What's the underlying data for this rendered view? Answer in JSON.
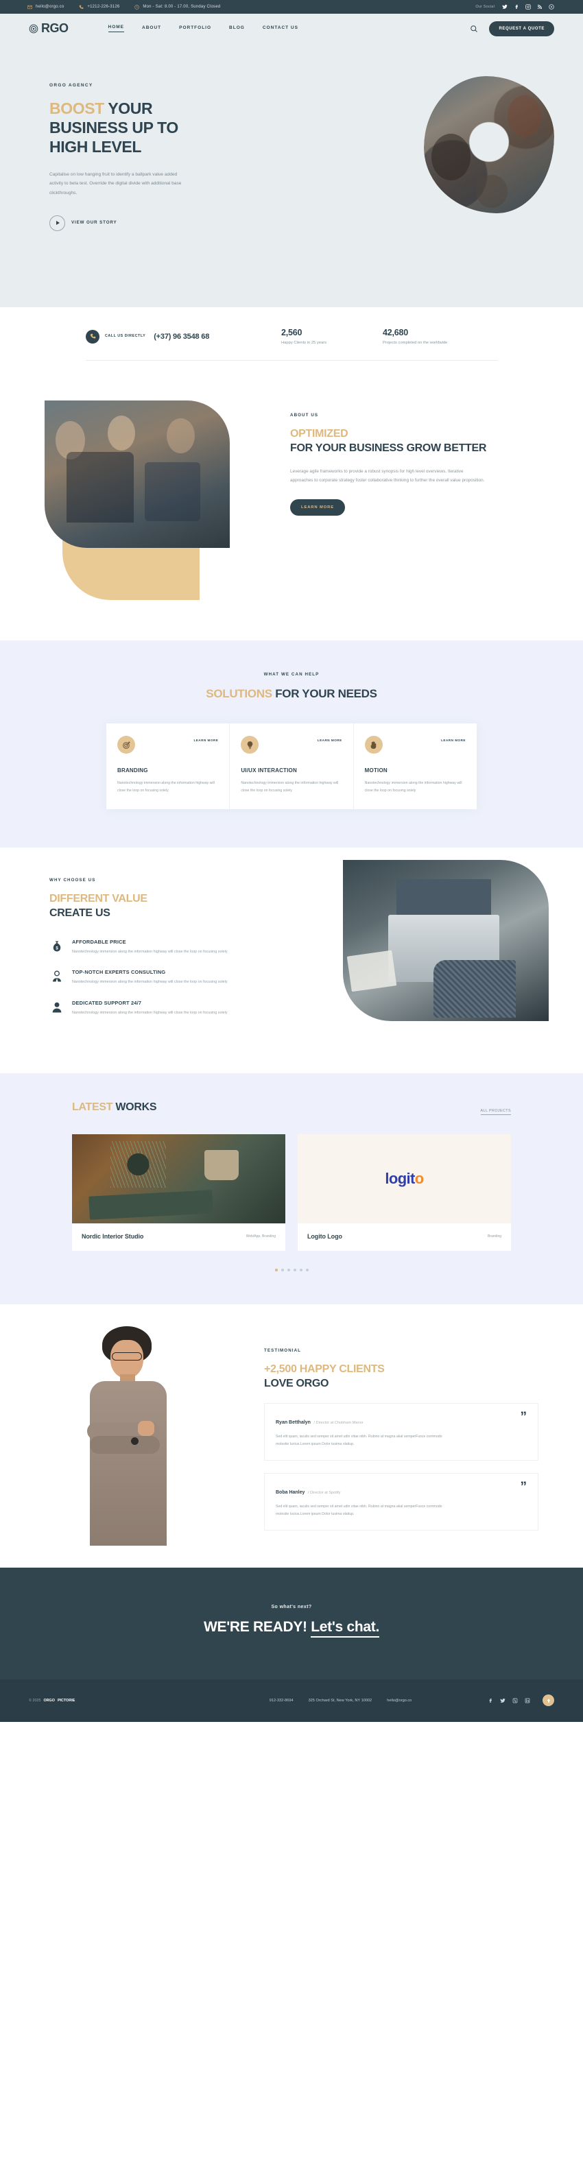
{
  "topbar": {
    "email": "hello@orgo.co",
    "phone": "+1212-226-3126",
    "hours": "Mon - Sat: 8.00 - 17.00, Sunday Closed",
    "social_label": "Our Social",
    "social": [
      "twitter-icon",
      "facebook-icon",
      "instagram-icon",
      "rss-icon",
      "youtube-icon"
    ]
  },
  "nav": {
    "brand": "RGO",
    "items": [
      {
        "label": "HOME",
        "active": true
      },
      {
        "label": "ABOUT",
        "active": false
      },
      {
        "label": "PORTFOLIO",
        "active": false
      },
      {
        "label": "BLOG",
        "active": false
      },
      {
        "label": "CONTACT US",
        "active": false
      }
    ],
    "quote_button": "REQUEST A QUOTE"
  },
  "hero": {
    "eyebrow": "ORGO AGENCY",
    "title_accent": "BOOST",
    "title_rest": " YOUR BUSINESS UP TO HIGH LEVEL",
    "description": "Capitalise on low hanging fruit to identify a ballpark value added activity to beta test. Override the digital divide with additional base clickthroughs.",
    "play_label": "VIEW OUR STORY"
  },
  "stats": {
    "call_label": "CALL US DIRECTLY",
    "call_number": "(+37) 96 3548 68",
    "items": [
      {
        "number": "2,560",
        "label": "Happy Clients in 25 years"
      },
      {
        "number": "42,680",
        "label": "Projects completed on the worldwide"
      }
    ]
  },
  "about": {
    "eyebrow": "ABOUT US",
    "title_accent": "OPTIMIZED",
    "title_rest": "FOR YOUR BUSINESS GROW BETTER",
    "description": "Leverage agile frameworks to provide a robust synopsis for high level overviews. Iterative approaches to corporate strategy foster collaborative thinking to further the overall value proposition.",
    "button": "LEARN MORE"
  },
  "solutions": {
    "eyebrow": "WHAT WE CAN HELP",
    "title_accent": "SOLUTIONS",
    "title_rest": " FOR YOUR NEEDS",
    "learn_more": "LEARN MORE",
    "cards": [
      {
        "icon": "target-icon",
        "title": "BRANDING",
        "text": "Nanotechnology immersion along the information highway will close the loop on focusing solely"
      },
      {
        "icon": "lightbulb-icon",
        "title": "UI/UX INTERACTION",
        "text": "Nanotechnology immersion along the information highway will close the loop on focusing solely"
      },
      {
        "icon": "hand-icon",
        "title": "MOTION",
        "text": "Nanotechnology immersion along the information highway will close the loop on focusing solely"
      }
    ]
  },
  "why": {
    "eyebrow": "WHY CHOOSE US",
    "title_accent": "DIFFERENT VALUE",
    "title_rest": "CREATE US",
    "features": [
      {
        "icon": "money-bag-icon",
        "title": "AFFORDABLE PRICE",
        "text": "Nanotechnology immersion along the information highway will close the loop on focusing solely"
      },
      {
        "icon": "businessman-icon",
        "title": "TOP-NOTCH EXPERTS CONSULTING",
        "text": "Nanotechnology immersion along the information highway will close the loop on focusing solely"
      },
      {
        "icon": "user-support-icon",
        "title": "DEDICATED SUPPORT 24/7",
        "text": "Nanotechnology immersion along the information highway will close the loop on focusing solely"
      }
    ]
  },
  "works": {
    "title_accent": "LATEST",
    "title_rest": " WORKS",
    "all_projects": "ALL PROJECTS",
    "items": [
      {
        "title": "Nordic Interior Studio",
        "category": "Web/App, Branding"
      },
      {
        "title": "Logito Logo",
        "category": "Branding"
      }
    ],
    "logito_part1": "logit",
    "logito_part2": "o",
    "dots": 6,
    "active_dot": 0
  },
  "testimonial": {
    "eyebrow": "TESTIMONIAL",
    "title_accent": "+2,500 HAPPY CLIENTS",
    "title_rest": "LOVE ORGO",
    "items": [
      {
        "name": "Ryan Betthalyn",
        "role": "/ Director at Chobham Manor",
        "text": "Sed elit quam, iaculis sed semper sit amet udin vitae nibh. Rubino at magna akal semperFusce commodo molestie luctus.Lorem ipsum Dolor tusima olatiup."
      },
      {
        "name": "Boba Hanley",
        "role": "/ Director at Spotify",
        "text": "Sed elit quam, iaculis sed semper sit amet udin vitae nibh. Rubino at magna akal semperFusce commodo molestie luctus.Lorem ipsum Dolor tusima olatiup."
      }
    ]
  },
  "cta": {
    "small": "So what's next?",
    "big_first": "WE'RE READY!",
    "big_link": "Let's chat."
  },
  "footer": {
    "copyright_pre": "© 2025",
    "copyright_brand": "ORGO",
    "copyright_post": "PICTORIE",
    "phone": "912-332-8694",
    "address": "325 Orchard St, New York, NY 10002",
    "email": "hello@orgo.co",
    "social": [
      "facebook-icon",
      "twitter-icon",
      "dribbble-icon",
      "linkedin-icon"
    ],
    "to_top": "back-to-top"
  },
  "colors": {
    "accent": "#deb87e",
    "dark": "#31454f",
    "light_bg": "#e8edef",
    "lavender_bg": "#eef1fb"
  }
}
